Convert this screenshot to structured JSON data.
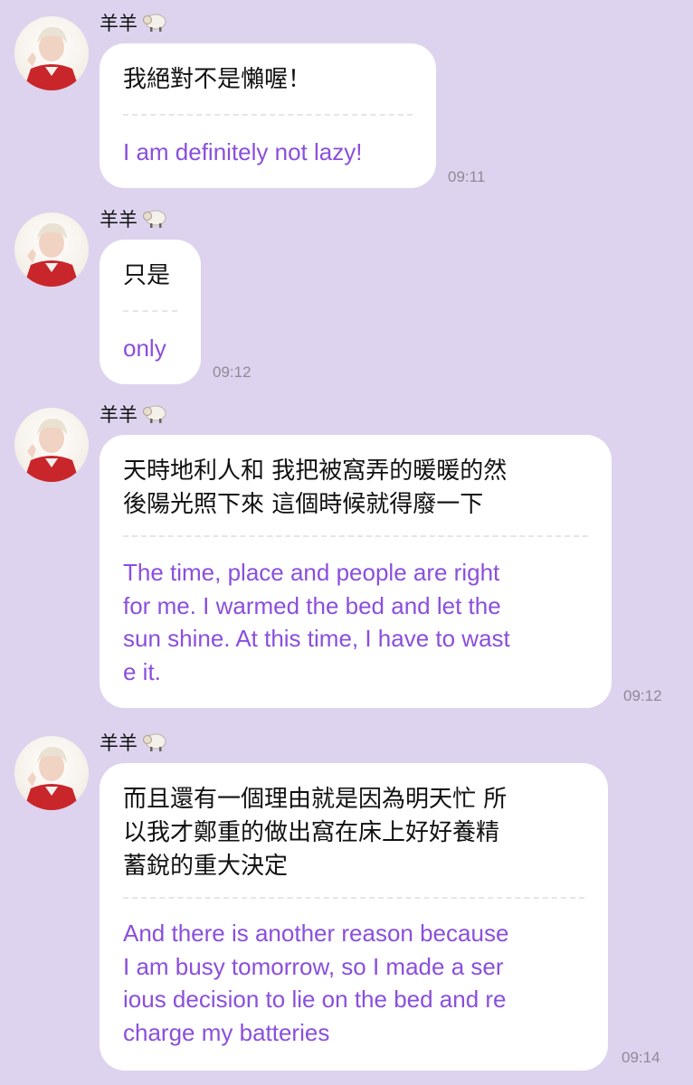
{
  "messages": [
    {
      "sender": "羊羊",
      "sender_icon": "sheep-emoji",
      "original": "我絕對不是懶喔！",
      "translation": "I am definitely not lazy!",
      "time": "09:11"
    },
    {
      "sender": "羊羊",
      "sender_icon": "sheep-emoji",
      "original": "只是",
      "translation": "only",
      "time": "09:12"
    },
    {
      "sender": "羊羊",
      "sender_icon": "sheep-emoji",
      "original": "天時地利人和 我把被窩弄的暖暖的然\n後陽光照下來 這個時候就得廢一下",
      "translation": "The time, place and people are right\nfor me. I warmed the bed and let the\nsun shine. At this time, I have to wast\ne it.",
      "time": "09:12"
    },
    {
      "sender": "羊羊",
      "sender_icon": "sheep-emoji",
      "original": "而且還有一個理由就是因為明天忙 所\n以我才鄭重的做出窩在床上好好養精\n蓄銳的重大決定",
      "translation": "And there is another reason because\n I am busy tomorrow, so I made a ser\nious decision to lie on the bed and re\ncharge my batteries",
      "time": "09:14"
    }
  ],
  "colors": {
    "background": "#ddd3ee",
    "bubble": "#ffffff",
    "translation_text": "#8a4fdd",
    "timestamp": "#8f8a97"
  }
}
